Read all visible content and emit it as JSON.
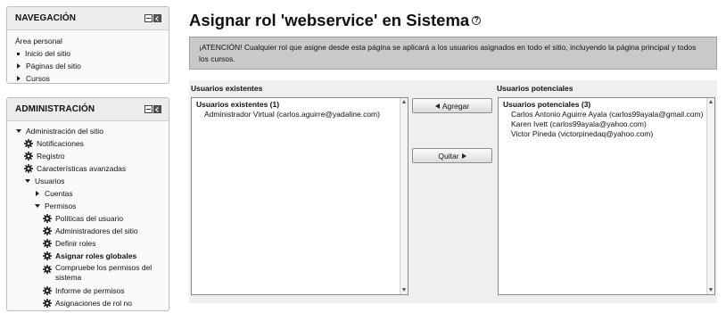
{
  "navigation": {
    "title": "NAVEGACIÓN",
    "items": [
      {
        "label": "Área personal",
        "marker": "none"
      },
      {
        "label": "Inicio del sitio",
        "marker": "bullet"
      },
      {
        "label": "Páginas del sitio",
        "marker": "triangle-right"
      },
      {
        "label": "Cursos",
        "marker": "triangle-right"
      }
    ]
  },
  "administration": {
    "title": "ADMINISTRACIÓN",
    "site_admin": "Administración del sitio",
    "notificaciones": "Notificaciones",
    "registro": "Registro",
    "caracteristicas": "Características avanzadas",
    "usuarios": "Usuarios",
    "cuentas": "Cuentas",
    "permisos": "Permisos",
    "politicas": "Políticas del usuario",
    "administradores": "Administradores del sitio",
    "definir": "Definir roles",
    "asignar_globales": "Asignar roles globales",
    "compruebe": "Compruebe los permisos del sistema",
    "informe": "Informe de permisos",
    "asignaciones": "Asignaciones de rol no"
  },
  "page": {
    "title": "Asignar rol 'webservice' en Sistema",
    "help_icon": "question-circle-icon",
    "notice": "¡ATENCIÓN! Cualquier rol que asigne desde esta página se aplicará a los usuarios asignados en todo el sitio, incluyendo la página principal y todos los cursos."
  },
  "existing": {
    "label": "Usuarios existentes",
    "group": "Usuarios existentes (1)",
    "users": [
      "Administrador Virtual (carlos.aguirre@yadaline.com)"
    ]
  },
  "potential": {
    "label": "Usuarios potenciales",
    "group": "Usuarios potenciales (3)",
    "users": [
      "Carlos Antonio Aguirre Ayala (carlos99ayala@gmail.com)",
      "Karen Ivett (carlos99ayala@yahoo.com)",
      "Victor Pineda (victorpinedaq@yahoo.com)"
    ]
  },
  "buttons": {
    "add": "Agregar",
    "remove": "Quitar"
  },
  "colors": {
    "notice_bg": "#c9c9c9",
    "selector_bg": "#efefef",
    "block_header": "#ececec"
  }
}
